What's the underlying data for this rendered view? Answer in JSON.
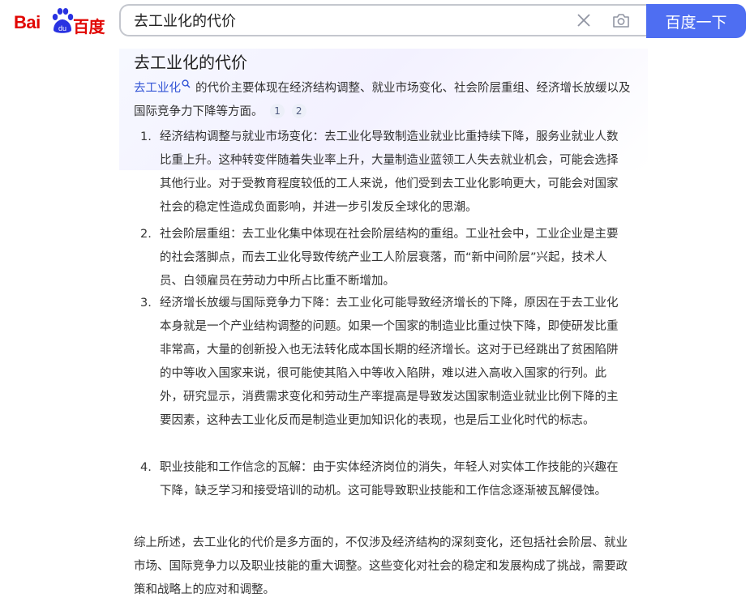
{
  "logo": {
    "text_left": "Bai",
    "text_mid": "du",
    "text_right": "百度",
    "brand_red": "#e10602",
    "brand_blue": "#2932e1"
  },
  "search": {
    "query": "去工业化的代价",
    "button_label": "百度一下",
    "clear_icon": "close-icon",
    "camera_icon": "camera-icon",
    "accent": "#4e6ef2"
  },
  "answer": {
    "title": "去工业化的代价",
    "intro_link": "去工业化",
    "intro_text": "的代价主要体现在经济结构调整、就业市场变化、社会阶层重组、经济增长放缓以及国际竞争力下降等方面。",
    "refs": [
      "1",
      "2"
    ],
    "items": [
      {
        "num": "1.",
        "text": "经济结构调整与就业市场变化：去工业化导致制造业就业比重持续下降，服务业就业人数比重上升。这种转变伴随着失业率上升，大量制造业蓝领工人失去就业机会，可能会选择其他行业。对于受教育程度较低的工人来说，他们受到去工业化影响更大，可能会对国家社会的稳定性造成负面影响，并进一步引发反全球化的思潮。"
      },
      {
        "num": "2.",
        "text": "社会阶层重组：去工业化集中体现在社会阶层结构的重组。工业社会中，工业企业是主要的社会落脚点，而去工业化导致传统产业工人阶层衰落，而“新中间阶层”兴起，技术人员、白领雇员在劳动力中所占比重不断增加。"
      },
      {
        "num": "3.",
        "text": "经济增长放缓与国际竞争力下降：去工业化可能导致经济增长的下降，原因在于去工业化本身就是一个产业结构调整的问题。如果一个国家的制造业比重过快下降，即使研发比重非常高，大量的创新投入也无法转化成本国长期的经济增长。这对于已经跳出了贫困陷阱的中等收入国家来说，很可能使其陷入中等收入陷阱，难以进入高收入国家的行列。此外，研究显示，消费需求变化和劳动生产率提高是导致发达国家制造业就业比例下降的主要因素，这种去工业化反而是制造业更加知识化的表现，也是后工业化时代的标志。"
      },
      {
        "num": "4.",
        "text": "职业技能和工作信念的瓦解：由于实体经济岗位的消失，年轻人对实体工作技能的兴趣在下降，缺乏学习和接受培训的动机。这可能导致职业技能和工作信念逐渐被瓦解侵蚀。"
      }
    ],
    "summary": "综上所述，去工业化的代价是多方面的，不仅涉及经济结构的深刻变化，还包括社会阶层、就业市场、国际竞争力以及职业技能的重大调整。这些变化对社会的稳定和发展构成了挑战，需要政策和战略上的应对和调整。",
    "link_color": "#3254d6"
  }
}
